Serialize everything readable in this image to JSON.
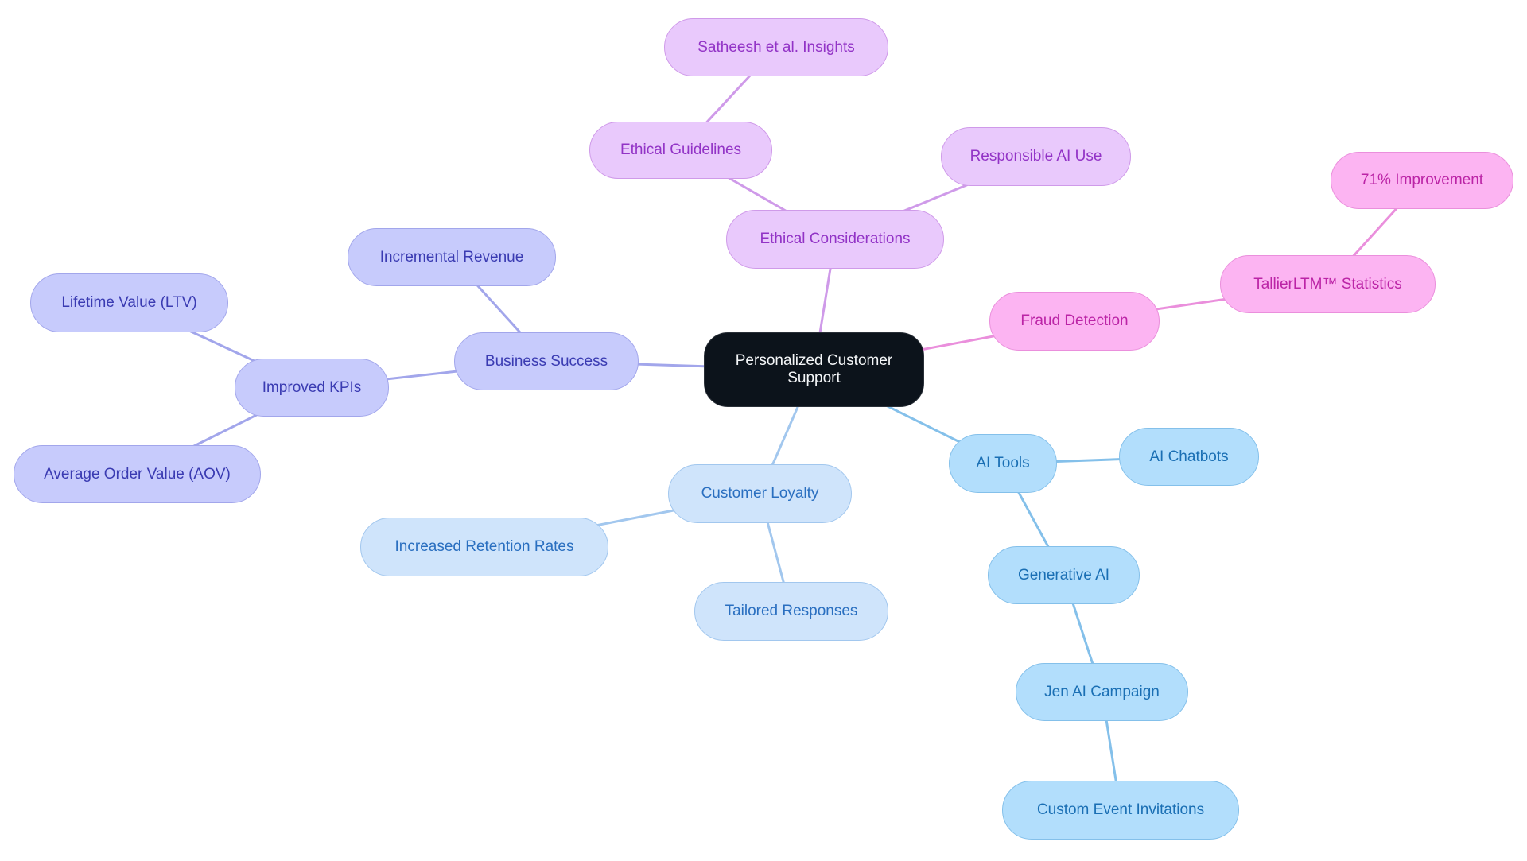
{
  "diagram": {
    "type": "mindmap",
    "root": {
      "id": "root",
      "label": "Personalized Customer Support"
    },
    "colors": {
      "root_fill": "#0c131b",
      "ethics": "#cf9ae9",
      "fraud": "#ea8fdc",
      "business": "#a2a6eb",
      "loyalty": "#a2c7ee",
      "ai": "#84c0ea"
    },
    "nodes": [
      {
        "id": "ethical-considerations",
        "label": "Ethical Considerations",
        "parent": "root",
        "group": "purple"
      },
      {
        "id": "ethical-guidelines",
        "label": "Ethical Guidelines",
        "parent": "ethical-considerations",
        "group": "purple"
      },
      {
        "id": "satheesh-insights",
        "label": "Satheesh et al. Insights",
        "parent": "ethical-guidelines",
        "group": "purple"
      },
      {
        "id": "responsible-ai-use",
        "label": "Responsible AI Use",
        "parent": "ethical-considerations",
        "group": "purple"
      },
      {
        "id": "fraud-detection",
        "label": "Fraud Detection",
        "parent": "root",
        "group": "pink"
      },
      {
        "id": "tallier-statistics",
        "label": "TallierLTM™ Statistics",
        "parent": "fraud-detection",
        "group": "pink"
      },
      {
        "id": "improvement-71",
        "label": "71% Improvement",
        "parent": "tallier-statistics",
        "group": "pink"
      },
      {
        "id": "business-success",
        "label": "Business Success",
        "parent": "root",
        "group": "indigo"
      },
      {
        "id": "incremental-revenue",
        "label": "Incremental Revenue",
        "parent": "business-success",
        "group": "indigo"
      },
      {
        "id": "improved-kpis",
        "label": "Improved KPIs",
        "parent": "business-success",
        "group": "indigo"
      },
      {
        "id": "lifetime-value",
        "label": "Lifetime Value (LTV)",
        "parent": "improved-kpis",
        "group": "indigo"
      },
      {
        "id": "average-order-value",
        "label": "Average Order Value (AOV)",
        "parent": "improved-kpis",
        "group": "indigo"
      },
      {
        "id": "customer-loyalty",
        "label": "Customer Loyalty",
        "parent": "root",
        "group": "lblue"
      },
      {
        "id": "increased-retention",
        "label": "Increased Retention Rates",
        "parent": "customer-loyalty",
        "group": "lblue"
      },
      {
        "id": "tailored-responses",
        "label": "Tailored Responses",
        "parent": "customer-loyalty",
        "group": "lblue"
      },
      {
        "id": "ai-tools",
        "label": "AI Tools",
        "parent": "root",
        "group": "sky"
      },
      {
        "id": "ai-chatbots",
        "label": "AI Chatbots",
        "parent": "ai-tools",
        "group": "sky"
      },
      {
        "id": "generative-ai",
        "label": "Generative AI",
        "parent": "ai-tools",
        "group": "sky"
      },
      {
        "id": "jen-ai-campaign",
        "label": "Jen AI Campaign",
        "parent": "generative-ai",
        "group": "sky"
      },
      {
        "id": "custom-event-invitations",
        "label": "Custom Event Invitations",
        "parent": "jen-ai-campaign",
        "group": "sky"
      }
    ]
  }
}
